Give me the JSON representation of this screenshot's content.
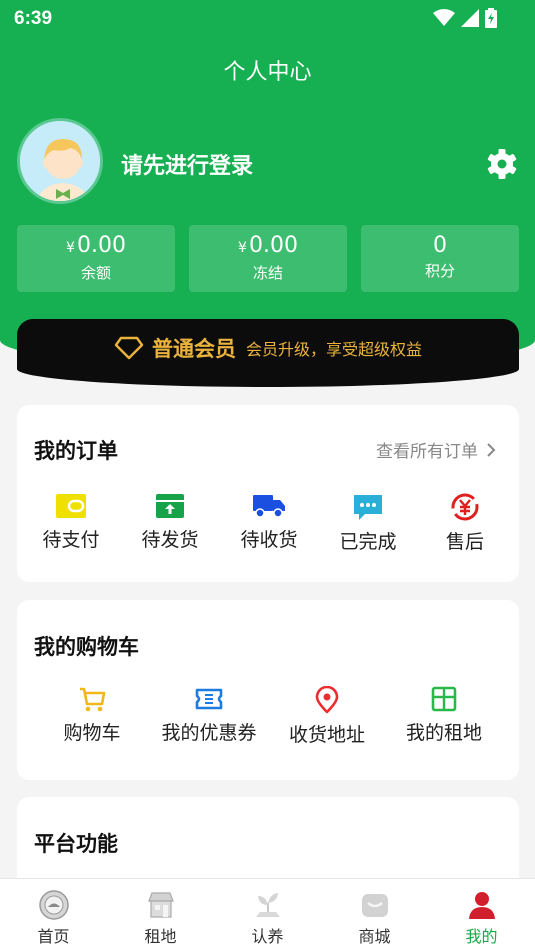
{
  "status": {
    "time": "6:39"
  },
  "header": {
    "title": "个人中心"
  },
  "profile": {
    "login_prompt": "请先进行登录"
  },
  "stats": [
    {
      "currency": "¥",
      "value": "0.00",
      "label": "余额"
    },
    {
      "currency": "¥",
      "value": "0.00",
      "label": "冻结"
    },
    {
      "currency": "",
      "value": "0",
      "label": "积分"
    }
  ],
  "member": {
    "level": "普通会员",
    "description": "会员升级，享受超级权益"
  },
  "orders": {
    "title": "我的订单",
    "view_all": "查看所有订单",
    "items": [
      {
        "label": "待支付",
        "icon": "wallet-icon",
        "color": "#f0e000"
      },
      {
        "label": "待发货",
        "icon": "box-upload-icon",
        "color": "#17a34a"
      },
      {
        "label": "待收货",
        "icon": "truck-icon",
        "color": "#1a4fe0"
      },
      {
        "label": "已完成",
        "icon": "chat-bubble-icon",
        "color": "#2ab0d8"
      },
      {
        "label": "售后",
        "icon": "yen-refund-icon",
        "color": "#e02020"
      }
    ]
  },
  "cart": {
    "title": "我的购物车",
    "items": [
      {
        "label": "购物车",
        "icon": "cart-icon",
        "color": "#f2b71b"
      },
      {
        "label": "我的优惠券",
        "icon": "coupon-icon",
        "color": "#1e7be0"
      },
      {
        "label": "收货地址",
        "icon": "location-icon",
        "color": "#ec2d2d"
      },
      {
        "label": "我的租地",
        "icon": "land-grid-icon",
        "color": "#2ab84a"
      }
    ]
  },
  "platform": {
    "title": "平台功能"
  },
  "tabs": [
    {
      "label": "首页",
      "icon": "home-logo-icon"
    },
    {
      "label": "租地",
      "icon": "store-icon"
    },
    {
      "label": "认养",
      "icon": "plant-icon"
    },
    {
      "label": "商城",
      "icon": "mall-icon"
    },
    {
      "label": "我的",
      "icon": "user-icon",
      "active": true
    }
  ],
  "colors": {
    "primary": "#16b052",
    "gold": "#e9b33c",
    "active_tab": "#19a944"
  }
}
